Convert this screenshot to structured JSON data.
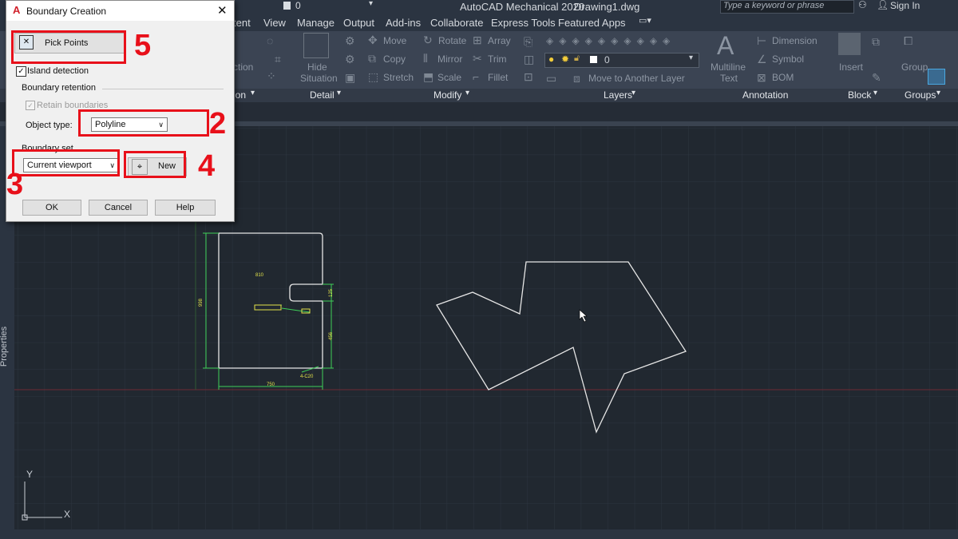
{
  "window": {
    "app_title": "AutoCAD Mechanical 2020",
    "file_name": "Drawing1.dwg",
    "search_placeholder": "Type a keyword or phrase",
    "sign_in": "Sign In",
    "layer_value": "0"
  },
  "tabs": [
    "tent",
    "View",
    "Manage",
    "Output",
    "Add-ins",
    "Collaborate",
    "Express Tools",
    "Featured Apps"
  ],
  "ribbon": {
    "hide_situation_1": "Hide",
    "hide_situation_2": "Situation",
    "ction_1": "ction",
    "modify": {
      "move": "Move",
      "rotate": "Rotate",
      "array": "Array",
      "copy": "Copy",
      "mirror": "Mirror",
      "trim": "Trim",
      "stretch": "Stretch",
      "scale": "Scale",
      "fillet": "Fillet"
    },
    "layer_current": "0",
    "move_to_another_layer": "Move to Another Layer",
    "multiline_1": "Multiline",
    "multiline_2": "Text",
    "dimension": "Dimension",
    "symbol": "Symbol",
    "bom": "BOM",
    "insert": "Insert",
    "group": "Group"
  },
  "ribbon_groups": {
    "ion": "ion",
    "detail": "Detail",
    "modify": "Modify",
    "layers": "Layers",
    "annotation": "Annotation",
    "block": "Block",
    "groups": "Groups"
  },
  "side_panel": {
    "properties": "Properties"
  },
  "drawing": {
    "dim_810": "810",
    "dim_998": "998",
    "dim_125": "125",
    "dim_456": "456",
    "dim_750": "750",
    "dim_c20": "4-C20"
  },
  "dialog": {
    "title": "Boundary Creation",
    "pick_points": "Pick Points",
    "island_detection": "Island detection",
    "island_checked": true,
    "boundary_retention": "Boundary retention",
    "retain_boundaries": "Retain boundaries",
    "object_type_label": "Object type:",
    "object_type_value": "Polyline",
    "boundary_set": "Boundary set",
    "boundary_set_value": "Current viewport",
    "new_label": "New",
    "ok": "OK",
    "cancel": "Cancel",
    "help": "Help"
  },
  "annotations": {
    "n5": "5",
    "n2": "2",
    "n3": "3",
    "n4": "4"
  },
  "ucs": {
    "x": "X",
    "y": "Y"
  },
  "colors": {
    "accent_red": "#e8101a",
    "dim_green": "#3ecf58",
    "dim_text": "#e2e24a",
    "grid": "#2b333e"
  }
}
